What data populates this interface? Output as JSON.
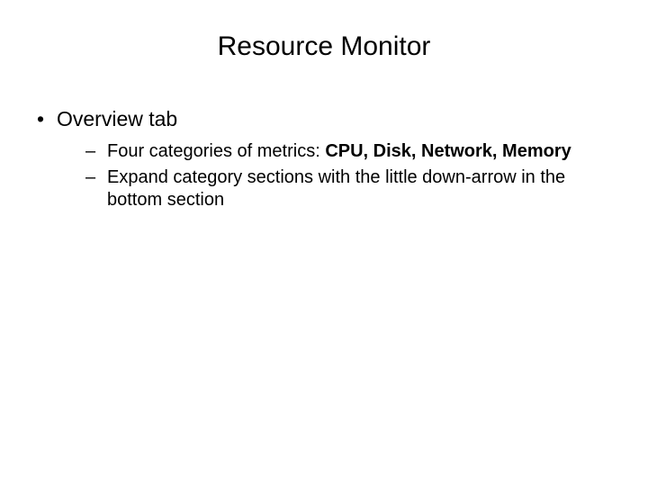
{
  "title": "Resource Monitor",
  "bullet1": "Overview tab",
  "sub1_prefix": "Four categories of metrics: ",
  "sub1_bold": "CPU, Disk, Network, Memory",
  "sub2": "Expand category sections with the little down-arrow in the bottom section"
}
